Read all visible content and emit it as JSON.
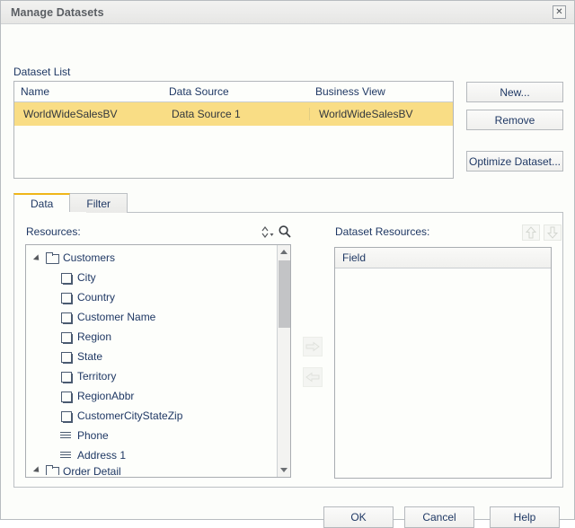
{
  "window": {
    "title": "Manage Datasets",
    "close_icon": "close-icon",
    "close_glyph": "✕"
  },
  "dataset_list": {
    "label": "Dataset List",
    "columns": [
      "Name",
      "Data Source",
      "Business View"
    ],
    "rows": [
      {
        "name": "WorldWideSalesBV",
        "data_source": "Data Source 1",
        "business_view": "WorldWideSalesBV",
        "selected": true
      }
    ],
    "selected_row_color": "#f9dd85"
  },
  "side_buttons": {
    "new": "New...",
    "remove": "Remove",
    "optimize": "Optimize Dataset..."
  },
  "tabs": {
    "items": [
      {
        "label": "Data",
        "active": true
      },
      {
        "label": "Filter",
        "active": false
      }
    ],
    "active_indicator_color": "#f0b619"
  },
  "resources": {
    "label": "Resources:",
    "sort_icon": "sort-icon",
    "search_icon": "search-icon",
    "tree": [
      {
        "label": "Customers",
        "type": "folder",
        "level": 0,
        "expanded": true
      },
      {
        "label": "City",
        "type": "field",
        "level": 1
      },
      {
        "label": "Country",
        "type": "field",
        "level": 1
      },
      {
        "label": "Customer Name",
        "type": "field",
        "level": 1
      },
      {
        "label": "Region",
        "type": "field",
        "level": 1
      },
      {
        "label": "State",
        "type": "field",
        "level": 1
      },
      {
        "label": "Territory",
        "type": "field",
        "level": 1
      },
      {
        "label": "RegionAbbr",
        "type": "field",
        "level": 1
      },
      {
        "label": "CustomerCityStateZip",
        "type": "field",
        "level": 1
      },
      {
        "label": "Phone",
        "type": "text",
        "level": 1
      },
      {
        "label": "Address 1",
        "type": "text",
        "level": 1
      },
      {
        "label": "Order Detail",
        "type": "folder",
        "level": 0,
        "clipped": true
      }
    ]
  },
  "transfer": {
    "add_icon": "arrow-right-icon",
    "remove_icon": "arrow-left-icon",
    "add_glyph": "⇨",
    "remove_glyph": "⇦"
  },
  "dataset_resources": {
    "label": "Dataset Resources:",
    "move_up_icon": "arrow-up-icon",
    "move_down_icon": "arrow-down-icon",
    "move_up_glyph": "⇧",
    "move_down_glyph": "⇩",
    "columns": [
      "Field"
    ],
    "rows": []
  },
  "footer": {
    "ok": "OK",
    "cancel": "Cancel",
    "help": "Help"
  }
}
